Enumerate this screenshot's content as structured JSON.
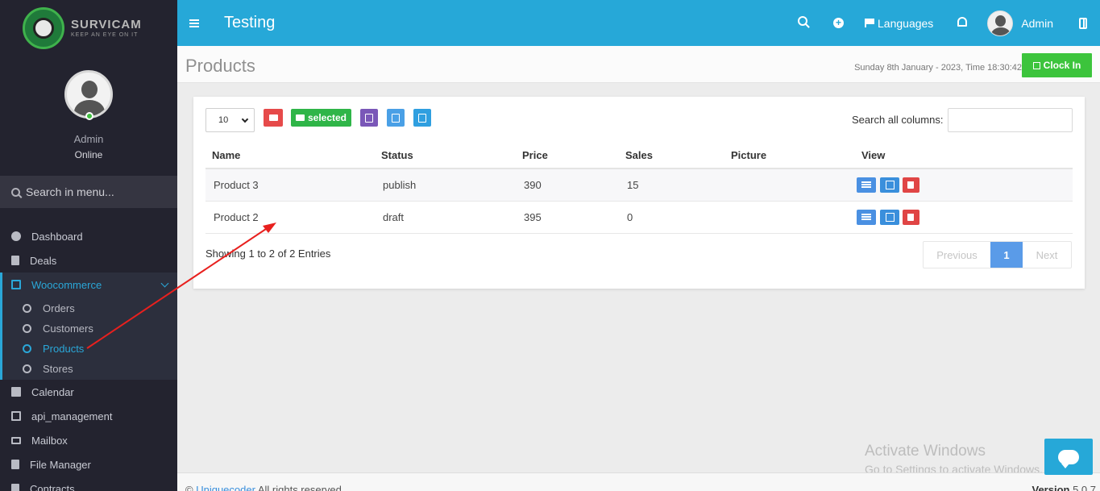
{
  "brand": {
    "name": "SURVICAM",
    "tagline": "KEEP AN EYE ON IT"
  },
  "user": {
    "name": "Admin",
    "status": "Online"
  },
  "sidebar": {
    "search_placeholder": "Search in menu...",
    "items": [
      {
        "label": "Dashboard",
        "icon": "dashboard-icon"
      },
      {
        "label": "Deals",
        "icon": "file-icon"
      },
      {
        "label": "Woocommerce",
        "icon": "excel-icon",
        "expanded": true,
        "children": [
          {
            "label": "Orders"
          },
          {
            "label": "Customers"
          },
          {
            "label": "Products",
            "active": true
          },
          {
            "label": "Stores"
          }
        ]
      },
      {
        "label": "Calendar",
        "icon": "calendar-icon"
      },
      {
        "label": "api_management",
        "icon": "excel-icon"
      },
      {
        "label": "Mailbox",
        "icon": "mail-icon"
      },
      {
        "label": "File Manager",
        "icon": "file-icon"
      },
      {
        "label": "Contracts",
        "icon": "file-icon"
      }
    ]
  },
  "topbar": {
    "title": "Testing",
    "languages": "Languages",
    "user": "Admin"
  },
  "header": {
    "title": "Products",
    "datetime": "Sunday 8th January - 2023,  Time  18:30:42",
    "clock_in": "Clock In"
  },
  "table": {
    "page_size": "10",
    "selected_label": "selected",
    "search_label": "Search all columns:",
    "columns": [
      "Name",
      "Status",
      "Price",
      "Sales",
      "Picture",
      "View"
    ],
    "rows": [
      [
        "Product 3",
        "publish",
        "390",
        "15",
        ""
      ],
      [
        "Product 2",
        "draft",
        "395",
        "0",
        ""
      ]
    ],
    "info": "Showing 1 to 2 of 2 Entries",
    "pagination": {
      "prev": "Previous",
      "current": "1",
      "next": "Next"
    }
  },
  "footer": {
    "prefix": "©",
    "company": "Uniquecoder",
    "rights": "All rights reserved.",
    "version_label": "Version",
    "version": "5.0.7"
  },
  "watermark": {
    "line1": "Activate Windows",
    "line2": "Go to Settings to activate Windows."
  },
  "colors": {
    "accent": "#26a8d8",
    "sidebar": "#23232f",
    "success": "#3cc43c",
    "danger": "#e64a4a"
  }
}
